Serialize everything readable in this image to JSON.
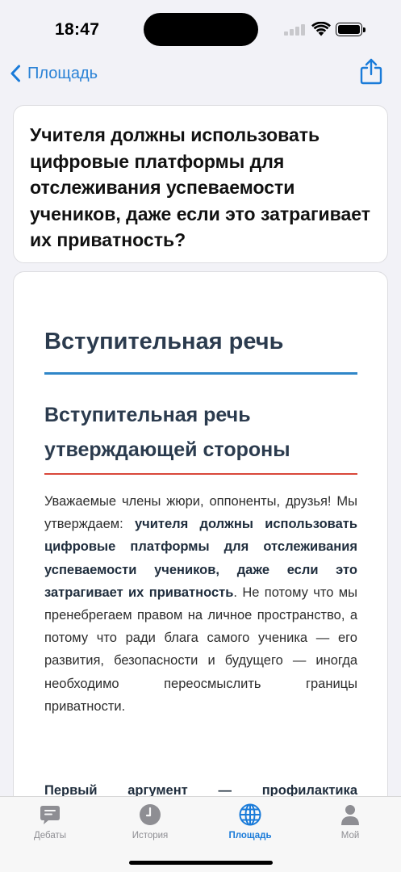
{
  "status_bar": {
    "time": "18:47"
  },
  "nav": {
    "back_label": "Площадь"
  },
  "question": {
    "title": "Учителя должны использовать цифровые платформы для отслеживания успеваемости учеников, даже если это затрагивает их приватность?"
  },
  "speech": {
    "heading": "Вступительная речь",
    "subheading": "Вступительная речь утверждающей стороны",
    "body_intro": "Уважаемые члены жюри, оппоненты, друзья! Мы утверждаем: ",
    "body_thesis": "учителя должны использовать цифровые платформы для отслеживания успеваемости учеников, даже если это затрагивает их приватность",
    "body_rest": ". Не потому что мы пренебрегаем правом на личное пространство, а потому что ради блага самого ученика — его развития, безопасности и будущего — иногда необходимо переосмыслить границы приватности.",
    "next_paragraph": "Первый аргумент — профилактика"
  },
  "tabs": [
    {
      "label": "Дебаты",
      "icon": "chat-bubble-icon",
      "active": false
    },
    {
      "label": "История",
      "icon": "clock-icon",
      "active": false
    },
    {
      "label": "Площадь",
      "icon": "globe-icon",
      "active": true
    },
    {
      "label": "Мой",
      "icon": "person-icon",
      "active": false
    }
  ],
  "colors": {
    "accent": "#1a7bd9",
    "heading_rule": "#2f86c8",
    "subheading_rule": "#d9473a",
    "heading_text": "#2b3b4e"
  }
}
